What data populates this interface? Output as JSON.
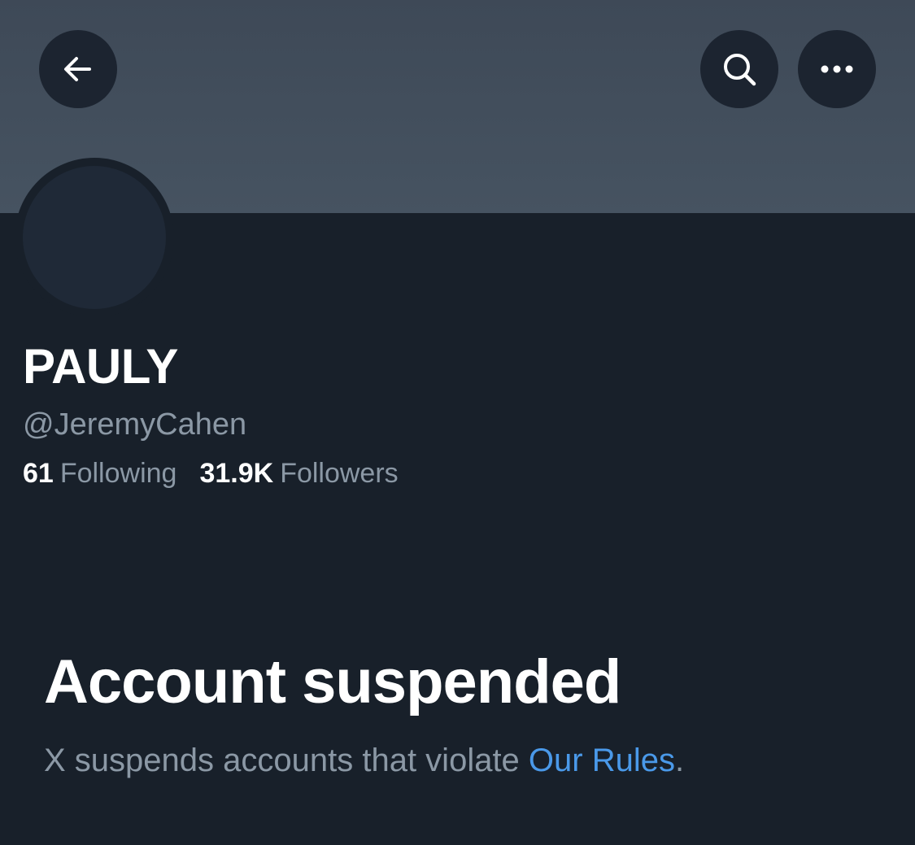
{
  "header": {
    "back_icon": "arrow-left-icon",
    "search_icon": "search-icon",
    "more_icon": "more-horizontal-icon"
  },
  "profile": {
    "display_name": "PAULY",
    "handle": "@JeremyCahen",
    "following_count": "61",
    "following_label": "Following",
    "followers_count": "31.9K",
    "followers_label": "Followers"
  },
  "suspension": {
    "title": "Account suspended",
    "message_prefix": "X suspends accounts that violate ",
    "rules_link": "Our Rules",
    "message_suffix": "."
  },
  "colors": {
    "background": "#18202a",
    "banner": "#425060",
    "button_bg": "#1c2430",
    "muted_text": "#8b98a5",
    "link": "#4a99e9",
    "primary_text": "#ffffff"
  }
}
